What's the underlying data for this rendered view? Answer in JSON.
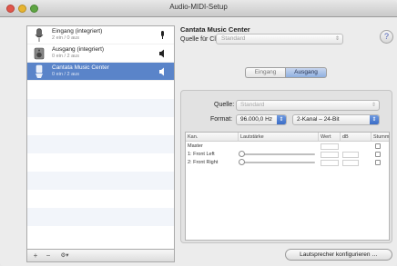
{
  "window": {
    "title": "Audio-MIDI-Setup"
  },
  "devices": [
    {
      "name": "Eingang (integriert)",
      "sub": "2 ein / 0 aus",
      "icon": "microphone-icon",
      "right": "microphone-small-icon",
      "selected": false
    },
    {
      "name": "Ausgang (integriert)",
      "sub": "0 ein / 2 aus",
      "icon": "speaker-icon",
      "right": "speaker-small-icon",
      "selected": false
    },
    {
      "name": "Cantata Music Center",
      "sub": "0 ein / 2 aus",
      "icon": "usb-device-icon",
      "right": "speaker-small-icon",
      "selected": true
    }
  ],
  "sidebar_footer": {
    "add": "+",
    "remove": "−",
    "gear": "⚙▾"
  },
  "detail": {
    "device_title": "Cantata Music Center",
    "clock_label": "Quelle für Clock:",
    "clock_value": "Standard",
    "help": "?",
    "tabs": [
      {
        "label": "Eingang"
      },
      {
        "label": "Ausgang"
      }
    ],
    "active_tab": "Ausgang",
    "source_label": "Quelle:",
    "source_value": "Standard",
    "format_label": "Format:",
    "format_rate": "96.000,0 Hz",
    "format_channels": "2-Kanal – 24-Bit",
    "table": {
      "headers": [
        "Kan.",
        "Lautstärke",
        "Wert",
        "dB",
        "Stumm"
      ],
      "rows": [
        {
          "name": "Master",
          "has_slider": false
        },
        {
          "name": "1: Front Left",
          "has_slider": true
        },
        {
          "name": "2: Front Right",
          "has_slider": true
        }
      ]
    },
    "configure_button": "Lautsprecher konfigurieren …"
  },
  "colors": {
    "selection": "#5a84c9",
    "tab_active": "#8fb0e0",
    "help": "#4b5fb8"
  }
}
